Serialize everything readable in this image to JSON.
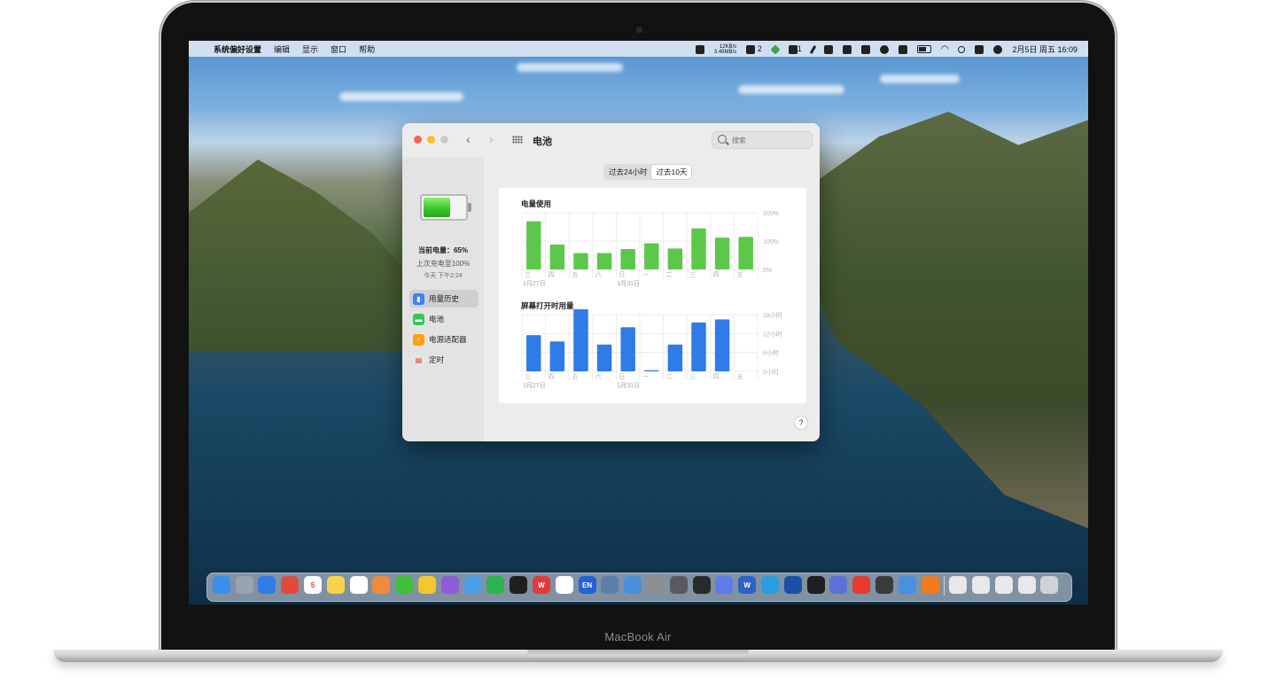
{
  "device": {
    "label": "MacBook Air"
  },
  "menubar": {
    "apple": "",
    "app_name": "系统偏好设置",
    "items": [
      "编辑",
      "显示",
      "窗口",
      "帮助"
    ],
    "net_up": "12KB/s",
    "net_down": "3.49MB/s",
    "wechat_count": "2",
    "qq_count": "1",
    "datetime": "2月5日 周五  16:09"
  },
  "window": {
    "title": "电池",
    "search_placeholder": "搜索",
    "back_label": "‹",
    "forward_label": "›",
    "help_label": "?"
  },
  "sidebar": {
    "charge_level_label": "当前电量：65%",
    "charge_level": 0.65,
    "last_charged": "上次充电至100%",
    "last_charged_time": "今天 下午2:24",
    "items": [
      {
        "label": "用量历史",
        "icon": "chart-bars-icon",
        "color": "#3b82f6",
        "active": true
      },
      {
        "label": "电池",
        "icon": "battery-icon",
        "color": "#34c759",
        "active": false
      },
      {
        "label": "电源适配器",
        "icon": "bolt-icon",
        "color": "#ff9f0a",
        "active": false
      },
      {
        "label": "定时",
        "icon": "calendar-icon",
        "color": "#e5e5ea",
        "active": false
      }
    ]
  },
  "range": {
    "options": [
      "过去24小时",
      "过去10天"
    ],
    "selected": 1
  },
  "chart_data": [
    {
      "type": "bar",
      "title": "电量使用",
      "categories": [
        "三",
        "四",
        "五",
        "六",
        "日",
        "一",
        "二",
        "三",
        "四",
        "五"
      ],
      "date_markers": [
        {
          "index": 0,
          "label": "1月27日"
        },
        {
          "index": 4,
          "label": "1月31日"
        }
      ],
      "values": [
        170,
        88,
        58,
        58,
        72,
        92,
        74,
        145,
        112,
        115
      ],
      "ylim": [
        0,
        200
      ],
      "yticks": [
        "200%",
        "100%",
        "0%"
      ],
      "color": "#5cc84a"
    },
    {
      "type": "bar",
      "title": "屏幕打开时用量",
      "categories": [
        "三",
        "四",
        "五",
        "六",
        "日",
        "一",
        "二",
        "三",
        "四",
        "五"
      ],
      "date_markers": [
        {
          "index": 0,
          "label": "1月27日"
        },
        {
          "index": 4,
          "label": "1月31日"
        }
      ],
      "values": [
        11.5,
        9.5,
        20.5,
        8.5,
        14,
        0.3,
        8.5,
        15.5,
        16.5,
        null
      ],
      "ylim": [
        0,
        18
      ],
      "yticks": [
        "18小时",
        "12小时",
        "6小时",
        "0小时"
      ],
      "color": "#2f7be8"
    }
  ],
  "dock": {
    "apps": [
      {
        "name": "finder-icon",
        "color": "#3b8fe8",
        "glyph": ""
      },
      {
        "name": "launchpad-icon",
        "color": "#9aa3b0",
        "glyph": ""
      },
      {
        "name": "safari-icon",
        "color": "#2f7be8",
        "glyph": ""
      },
      {
        "name": "chrome-icon",
        "color": "#e14a3b",
        "glyph": ""
      },
      {
        "name": "calendar-icon",
        "color": "#ffffff",
        "glyph": "5"
      },
      {
        "name": "notes-icon",
        "color": "#f6d34a",
        "glyph": ""
      },
      {
        "name": "reminders-icon",
        "color": "#ffffff",
        "glyph": ""
      },
      {
        "name": "photos-icon",
        "color": "#f08a3c",
        "glyph": ""
      },
      {
        "name": "wechat-icon",
        "color": "#3fbf3a",
        "glyph": ""
      },
      {
        "name": "nutstore-icon",
        "color": "#f2c531",
        "glyph": ""
      },
      {
        "name": "pinwheel-icon",
        "color": "#8f5bd6",
        "glyph": ""
      },
      {
        "name": "cap-icon",
        "color": "#4aa0e8",
        "glyph": ""
      },
      {
        "name": "evernote-icon",
        "color": "#2eb24a",
        "glyph": ""
      },
      {
        "name": "qq-icon",
        "color": "#1f1f1f",
        "glyph": ""
      },
      {
        "name": "wps-icon",
        "color": "#e33b3b",
        "glyph": "W"
      },
      {
        "name": "soccer-icon",
        "color": "#ffffff",
        "glyph": ""
      },
      {
        "name": "en-icon",
        "color": "#1f63d6",
        "glyph": "EN"
      },
      {
        "name": "network-icon",
        "color": "#5b7fa8",
        "glyph": ""
      },
      {
        "name": "weibo-icon",
        "color": "#4a8fd8",
        "glyph": ""
      },
      {
        "name": "settings-icon",
        "color": "#8e8e93",
        "glyph": ""
      },
      {
        "name": "printer-icon",
        "color": "#5a5a5e",
        "glyph": ""
      },
      {
        "name": "acrobat-icon",
        "color": "#2a2a2a",
        "glyph": ""
      },
      {
        "name": "tapd-icon",
        "color": "#5f7be8",
        "glyph": ""
      },
      {
        "name": "word-icon",
        "color": "#2b63c6",
        "glyph": "W"
      },
      {
        "name": "aliwangwang-icon",
        "color": "#2a9de0",
        "glyph": ""
      },
      {
        "name": "quicktime-icon",
        "color": "#1c4fa8",
        "glyph": ""
      },
      {
        "name": "terminal-icon",
        "color": "#1e1e1e",
        "glyph": ""
      },
      {
        "name": "books-icon",
        "color": "#5f6fd8",
        "glyph": ""
      },
      {
        "name": "gesture-icon",
        "color": "#e63b2e",
        "glyph": ""
      },
      {
        "name": "pen-icon",
        "color": "#3b3b3b",
        "glyph": ""
      },
      {
        "name": "puzzle-icon",
        "color": "#4b8fe0",
        "glyph": ""
      },
      {
        "name": "firefox-icon",
        "color": "#f27b20",
        "glyph": ""
      }
    ],
    "others": [
      {
        "name": "folder-camera-icon",
        "color": "#e8e8ea"
      },
      {
        "name": "folder-screenshots-icon",
        "color": "#e8e8ea"
      },
      {
        "name": "folder-docs-icon",
        "color": "#e8e8ea"
      },
      {
        "name": "folder-downloads-icon",
        "color": "#e8e8ea"
      },
      {
        "name": "trash-icon",
        "color": "#cfd3d8"
      }
    ]
  }
}
